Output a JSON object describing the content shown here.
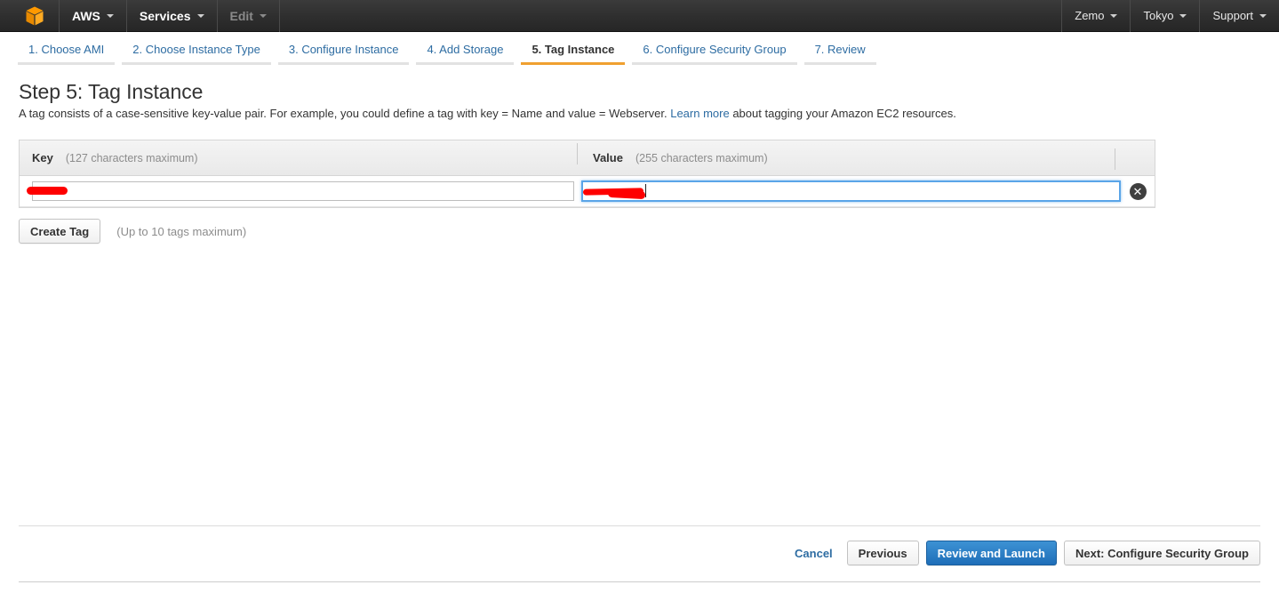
{
  "topnav": {
    "logo_icon": "aws-cube-icon",
    "logo_color": "#ff9900",
    "left_items": [
      {
        "label": "AWS",
        "state": "enabled",
        "caret": true
      },
      {
        "label": "Services",
        "state": "enabled",
        "caret": true
      },
      {
        "label": "Edit",
        "state": "disabled",
        "caret": true
      }
    ],
    "right_items": [
      {
        "label": "Zemo",
        "caret": true
      },
      {
        "label": "Tokyo",
        "caret": true
      },
      {
        "label": "Support",
        "caret": true
      }
    ]
  },
  "steps": {
    "active_index": 4,
    "active_underline_color": "#f0a030",
    "items": [
      {
        "label": "1. Choose AMI"
      },
      {
        "label": "2. Choose Instance Type"
      },
      {
        "label": "3. Configure Instance"
      },
      {
        "label": "4. Add Storage"
      },
      {
        "label": "5. Tag Instance"
      },
      {
        "label": "6. Configure Security Group"
      },
      {
        "label": "7. Review"
      }
    ]
  },
  "page": {
    "title": "Step 5: Tag Instance",
    "description_before_link": "A tag consists of a case-sensitive key-value pair. For example, you could define a tag with key = Name and value = Webserver.",
    "link_label": "Learn more",
    "description_after_link": "about tagging your Amazon EC2 resources."
  },
  "tag_table": {
    "key_column": {
      "label": "Key",
      "hint": "(127 characters maximum)"
    },
    "value_column": {
      "label": "Value",
      "hint": "(255 characters maximum)"
    },
    "rows": [
      {
        "key_value": "",
        "key_placeholder": "",
        "value_value": "",
        "value_placeholder": "",
        "value_focused": true,
        "delete_icon": "close-circle-icon",
        "redacted": true
      }
    ]
  },
  "create_tag": {
    "button_label": "Create Tag",
    "hint": "(Up to 10 tags maximum)"
  },
  "actions": {
    "cancel_label": "Cancel",
    "previous_label": "Previous",
    "review_launch_label": "Review and Launch",
    "next_label": "Next: Configure Security Group",
    "primary_color": "#1e6eb8",
    "link_color": "#2d6ca2"
  }
}
